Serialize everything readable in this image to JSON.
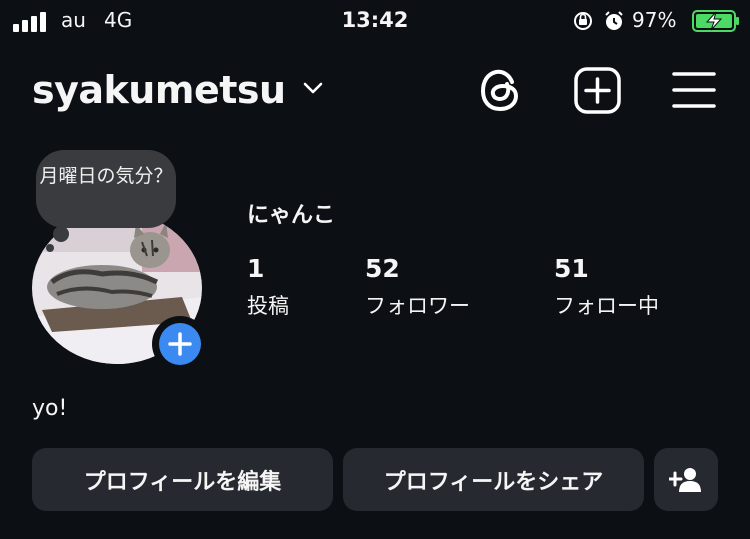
{
  "status_bar": {
    "carrier": "au",
    "network": "4G",
    "time": "13:42",
    "battery_percent": "97%",
    "icons": [
      "signal-icon",
      "orientation-lock-icon",
      "alarm-icon",
      "battery-charging-icon"
    ],
    "battery_color": "#4cd964"
  },
  "header": {
    "username": "syakumetsu",
    "icons": [
      "chevron-down-icon",
      "threads-icon",
      "create-plus-icon",
      "hamburger-menu-icon"
    ]
  },
  "profile": {
    "note": "月曜日の気分？",
    "display_name": "にゃんこ",
    "stats": [
      {
        "value": "1",
        "label": "投稿"
      },
      {
        "value": "52",
        "label": "フォロワー"
      },
      {
        "value": "51",
        "label": "フォロー中"
      }
    ],
    "bio": "yo!",
    "accent_color": "#3a8af2"
  },
  "actions": {
    "edit_profile": "プロフィールを編集",
    "share_profile": "プロフィールをシェア",
    "discover_people_icon": "add-person-icon"
  }
}
